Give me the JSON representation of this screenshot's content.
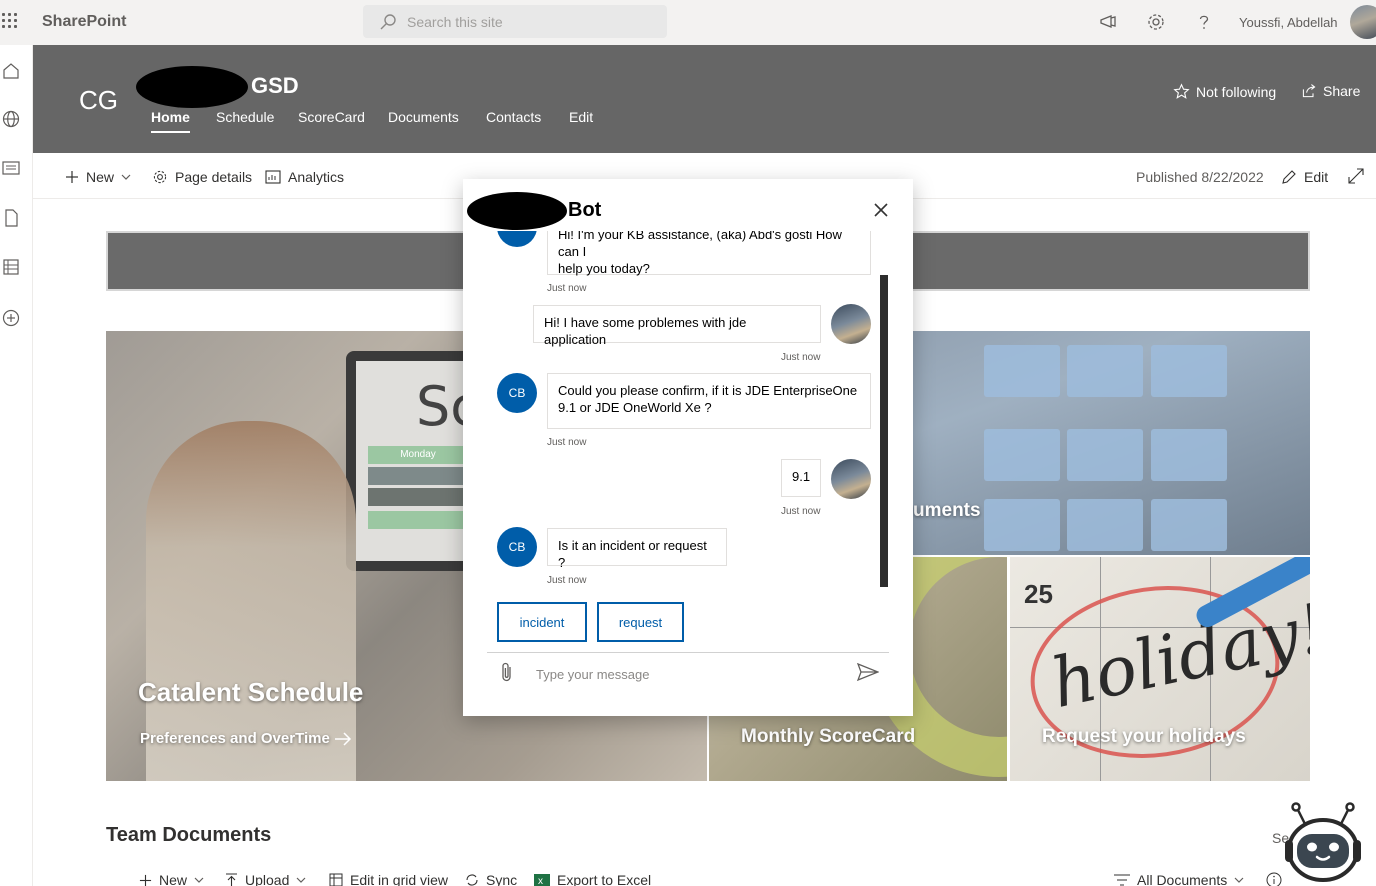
{
  "suite": {
    "brand": "SharePoint",
    "search_placeholder": "Search this site",
    "user_name": "Youssfi, Abdellah"
  },
  "site": {
    "logo_text": "CG",
    "title_suffix": "GSD",
    "nav": [
      {
        "label": "Home",
        "active": true
      },
      {
        "label": "Schedule"
      },
      {
        "label": "ScoreCard"
      },
      {
        "label": "Documents"
      },
      {
        "label": "Contacts"
      },
      {
        "label": "Edit"
      }
    ],
    "follow_label": "Not following",
    "share_label": "Share"
  },
  "command_bar": {
    "new_label": "New",
    "page_details_label": "Page details",
    "analytics_label": "Analytics",
    "published_label": "Published 8/22/2022",
    "edit_label": "Edit"
  },
  "tiles": {
    "schedule_title": "Catalent Schedule",
    "schedule_link": "Preferences and OverTime",
    "documents_title_partial": "uments",
    "scorecard_title": "Monthly ScoreCard",
    "holidays_title": "Request your holidays",
    "monitor_day": "Monday",
    "monitor_text": "Sc",
    "calendar_number": "25",
    "calendar_word": "holiday!"
  },
  "team_docs": {
    "heading": "Team Documents",
    "see_all_partial": "Se",
    "new_label": "New",
    "upload_label": "Upload",
    "grid_label": "Edit in grid view",
    "sync_label": "Sync",
    "export_label": "Export to Excel",
    "view_label": "All Documents"
  },
  "chat": {
    "title_suffix": "Bot",
    "bot_initials": "CB",
    "messages": [
      {
        "from": "bot",
        "text_line1": "Hi! I'm your KB assistance, (aka) Abd's gosti How can I",
        "text_line2": "help you today?",
        "time": "Just now"
      },
      {
        "from": "user",
        "text": "Hi! I have some problemes with jde application",
        "time": "Just now"
      },
      {
        "from": "bot",
        "text_line1": "Could you please confirm, if it is JDE EnterpriseOne",
        "text_line2": "9.1 or JDE OneWorld Xe ?",
        "time": "Just now"
      },
      {
        "from": "user",
        "text": "9.1",
        "time": "Just now"
      },
      {
        "from": "bot",
        "text": "Is it an incident or request ?",
        "time": "Just now"
      }
    ],
    "suggestions": [
      "incident",
      "request"
    ],
    "input_placeholder": "Type your message"
  },
  "colors": {
    "header_bg": "#666666",
    "bot_accent": "#005da9"
  },
  "icons": [
    "app-launcher-icon",
    "search-icon",
    "megaphone-icon",
    "gear-icon",
    "help-icon",
    "home-icon",
    "globe-icon",
    "news-icon",
    "page-icon",
    "list-icon",
    "add-circle-icon",
    "star-icon",
    "share-icon",
    "plus-icon",
    "chevron-down-icon",
    "analytics-icon",
    "pencil-icon",
    "expand-icon",
    "close-icon",
    "attach-icon",
    "send-icon",
    "arrow-right-icon",
    "robot-icon"
  ]
}
